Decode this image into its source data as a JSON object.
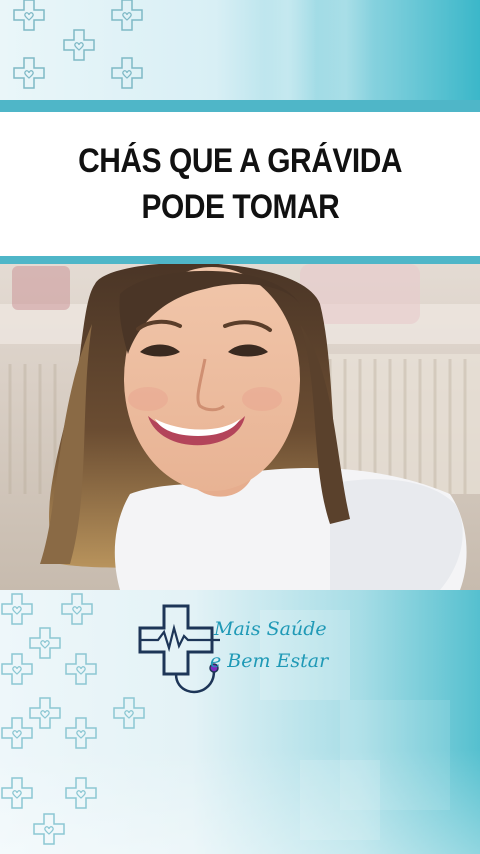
{
  "title": {
    "line1": "CHÁS QUE A GRÁVIDA",
    "line2": "PODE TOMAR"
  },
  "logo": {
    "line1": "Mais Saúde",
    "line2": "e Bem Estar",
    "icon": "medical-cross-heartbeat-stethoscope-icon"
  },
  "colors": {
    "accent": "#4fb6c8",
    "logo_text": "#1f99b6",
    "logo_icon": "#1d3557"
  }
}
